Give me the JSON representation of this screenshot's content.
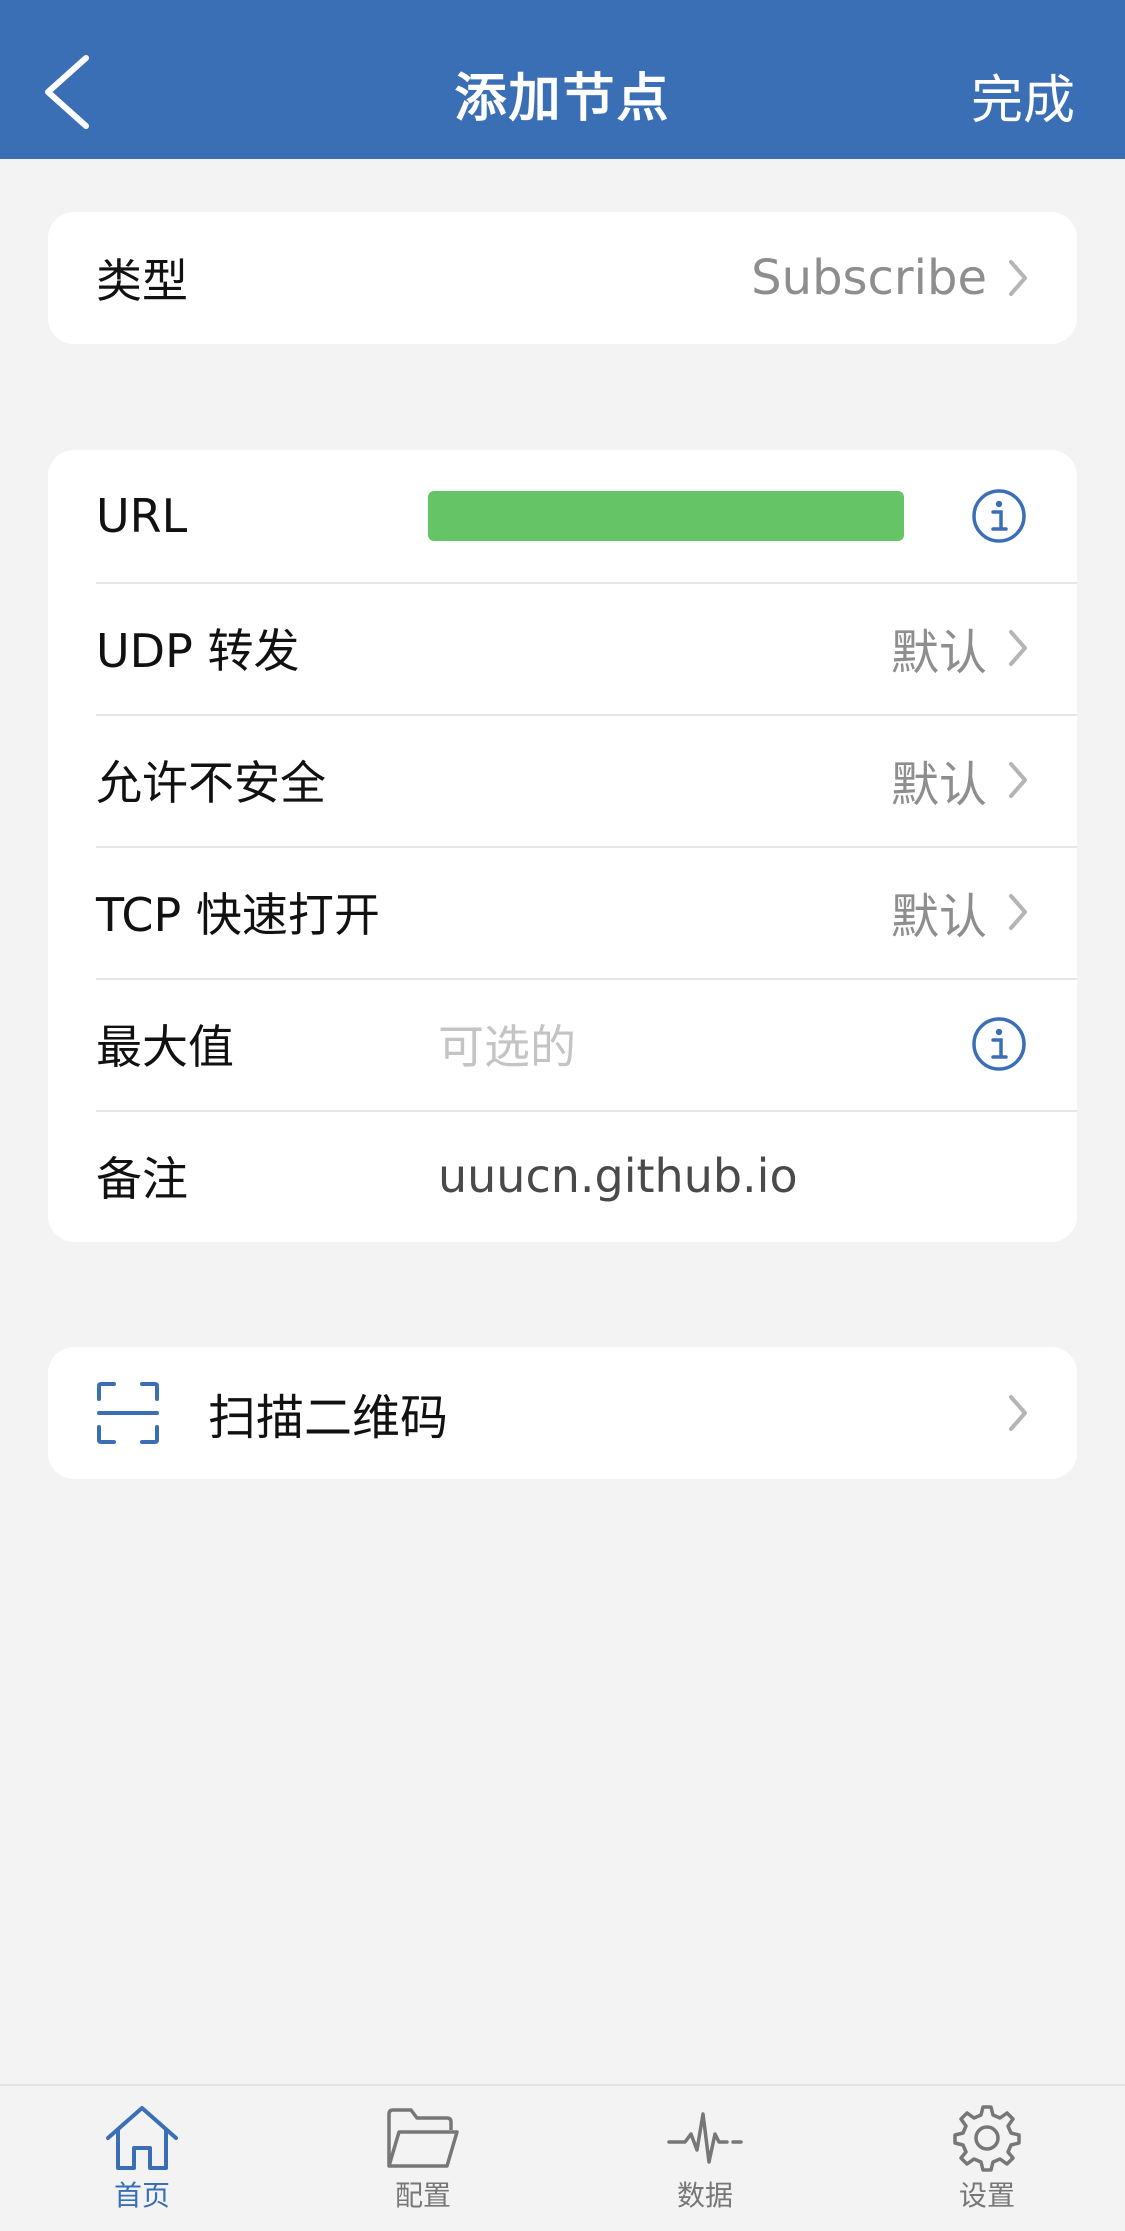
{
  "nav": {
    "title": "添加节点",
    "done": "完成"
  },
  "type_row": {
    "label": "类型",
    "value": "Subscribe"
  },
  "form": {
    "url_label": "URL",
    "udp_label": "UDP 转发",
    "udp_value": "默认",
    "insecure_label": "允许不安全",
    "insecure_value": "默认",
    "tcp_label": "TCP 快速打开",
    "tcp_value": "默认",
    "max_label": "最大值",
    "max_placeholder": "可选的",
    "note_label": "备注",
    "note_value": "uuucn.github.io"
  },
  "scan": {
    "label": "扫描二维码"
  },
  "tabs": [
    {
      "label": "首页",
      "icon": "home-icon",
      "active": true
    },
    {
      "label": "配置",
      "icon": "folder-icon",
      "active": false
    },
    {
      "label": "数据",
      "icon": "activity-icon",
      "active": false
    },
    {
      "label": "设置",
      "icon": "gear-icon",
      "active": false
    }
  ],
  "colors": {
    "accent": "#3a6fb6",
    "url_redaction": "#65c466",
    "background": "#f3f3f3"
  }
}
